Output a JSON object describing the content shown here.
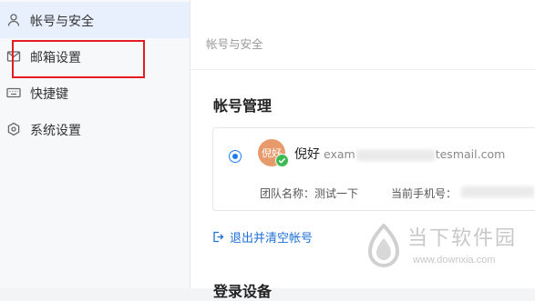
{
  "sidebar": {
    "items": [
      {
        "label": "帐号与安全",
        "icon": "user-icon",
        "active": true
      },
      {
        "label": "邮箱设置",
        "icon": "envelope-icon",
        "active": false
      },
      {
        "label": "快捷键",
        "icon": "keyboard-icon",
        "active": false
      },
      {
        "label": "系统设置",
        "icon": "gear-icon",
        "active": false
      }
    ]
  },
  "main": {
    "breadcrumb": "帐号与安全",
    "section_title": "帐号管理",
    "account": {
      "avatar_text": "倪好",
      "name": "倪好",
      "email_prefix": "exam",
      "email_suffix": "tesmail.com",
      "team_label": "团队名称：",
      "team_value": "测试一下",
      "phone_label": "当前手机号："
    },
    "logout_label": "退出并清空帐号",
    "next_section_title": "登录设备"
  },
  "watermark": {
    "brand": "当下软件园",
    "url": "www.downxia.com"
  },
  "colors": {
    "accent": "#1e7cf2",
    "annotation": "#e21b24",
    "verified": "#3fb953"
  }
}
